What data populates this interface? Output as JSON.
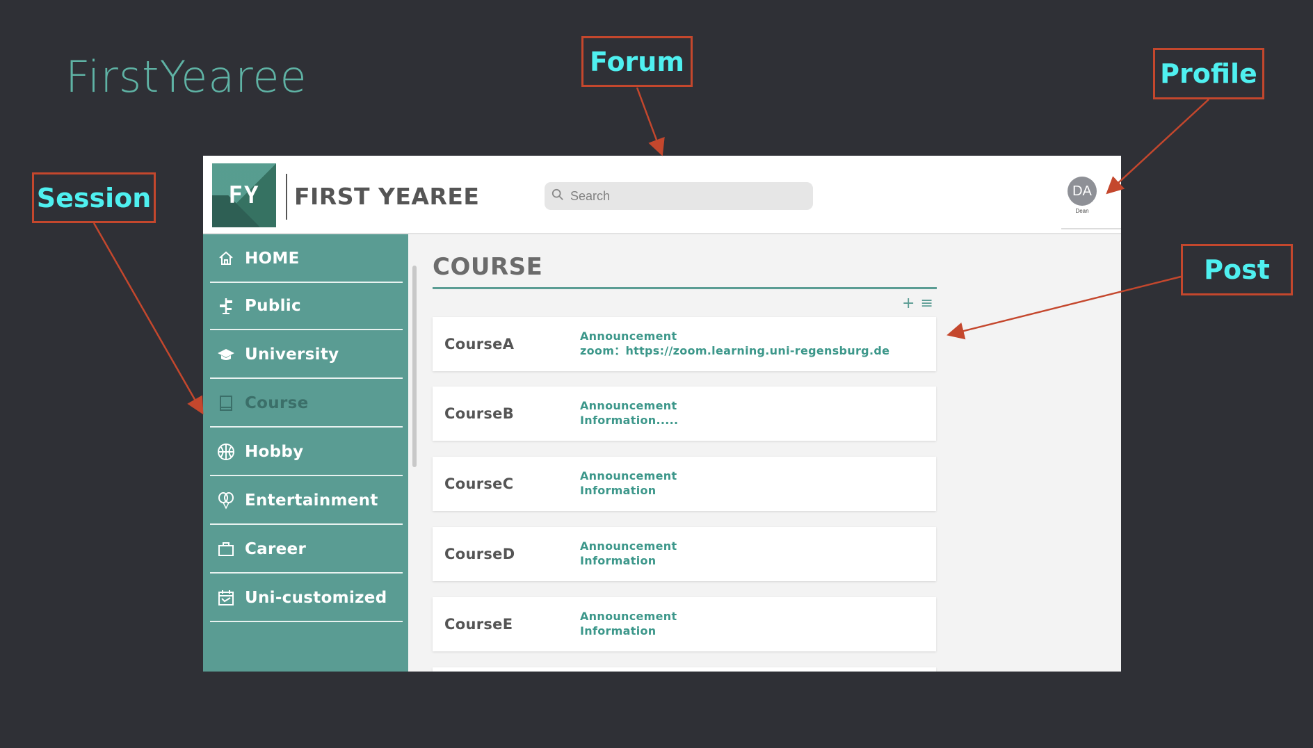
{
  "slide_title": "FirstYearee",
  "callouts": {
    "forum": "Forum",
    "profile": "Profile",
    "session": "Session",
    "post": "Post"
  },
  "header": {
    "logo_text": "FY",
    "brand": "FIRST YEAREE",
    "search_placeholder": "Search",
    "avatar_initials": "DA",
    "avatar_name": "Dean"
  },
  "sidebar": {
    "items": [
      {
        "label": "HOME",
        "icon": "home-icon"
      },
      {
        "label": "Public",
        "icon": "signpost-icon"
      },
      {
        "label": "University",
        "icon": "graduation-cap-icon"
      },
      {
        "label": "Course",
        "icon": "book-icon",
        "active": true
      },
      {
        "label": "Hobby",
        "icon": "basketball-icon"
      },
      {
        "label": "Entertainment",
        "icon": "balloons-icon"
      },
      {
        "label": "Career",
        "icon": "briefcase-icon"
      },
      {
        "label": "Uni-customized",
        "icon": "calendar-icon"
      }
    ]
  },
  "main": {
    "title": "COURSE",
    "toolbar": {
      "add": "+",
      "list": "≡"
    },
    "posts": [
      {
        "name": "CourseA",
        "line1": "Announcement",
        "line2": "zoom：https://zoom.learning.uni-regensburg.de"
      },
      {
        "name": "CourseB",
        "line1": "Announcement",
        "line2": "Information....."
      },
      {
        "name": "CourseC",
        "line1": "Announcement",
        "line2": "Information"
      },
      {
        "name": "CourseD",
        "line1": "Announcement",
        "line2": "Information"
      },
      {
        "name": "CourseE",
        "line1": "Announcement",
        "line2": "Information"
      }
    ]
  },
  "colors": {
    "background": "#2f3036",
    "accent": "#5a9c93",
    "callout_border": "#c4472d",
    "callout_text": "#4ff0f0"
  }
}
